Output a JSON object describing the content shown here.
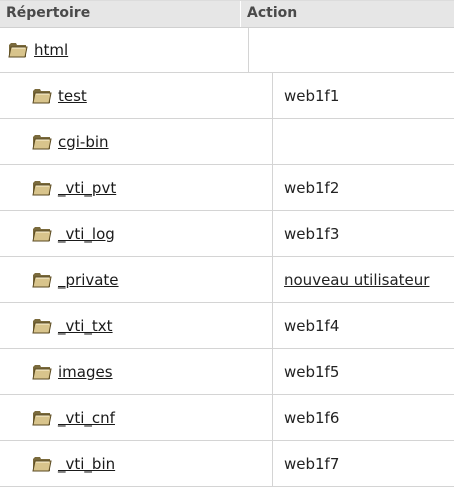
{
  "header": {
    "col_directory": "Répertoire",
    "col_action": "Action"
  },
  "rows": [
    {
      "name": "html",
      "action": ""
    },
    {
      "name": "test",
      "action": "web1f1"
    },
    {
      "name": "cgi-bin",
      "action": ""
    },
    {
      "name": "_vti_pvt",
      "action": "web1f2"
    },
    {
      "name": "_vti_log",
      "action": "web1f3"
    },
    {
      "name": "_private",
      "action": "nouveau utilisateur"
    },
    {
      "name": "_vti_txt",
      "action": "web1f4"
    },
    {
      "name": "images",
      "action": "web1f5"
    },
    {
      "name": "_vti_cnf",
      "action": "web1f6"
    },
    {
      "name": "_vti_bin",
      "action": "web1f7"
    }
  ],
  "icons": {
    "folder": "folder-icon"
  }
}
